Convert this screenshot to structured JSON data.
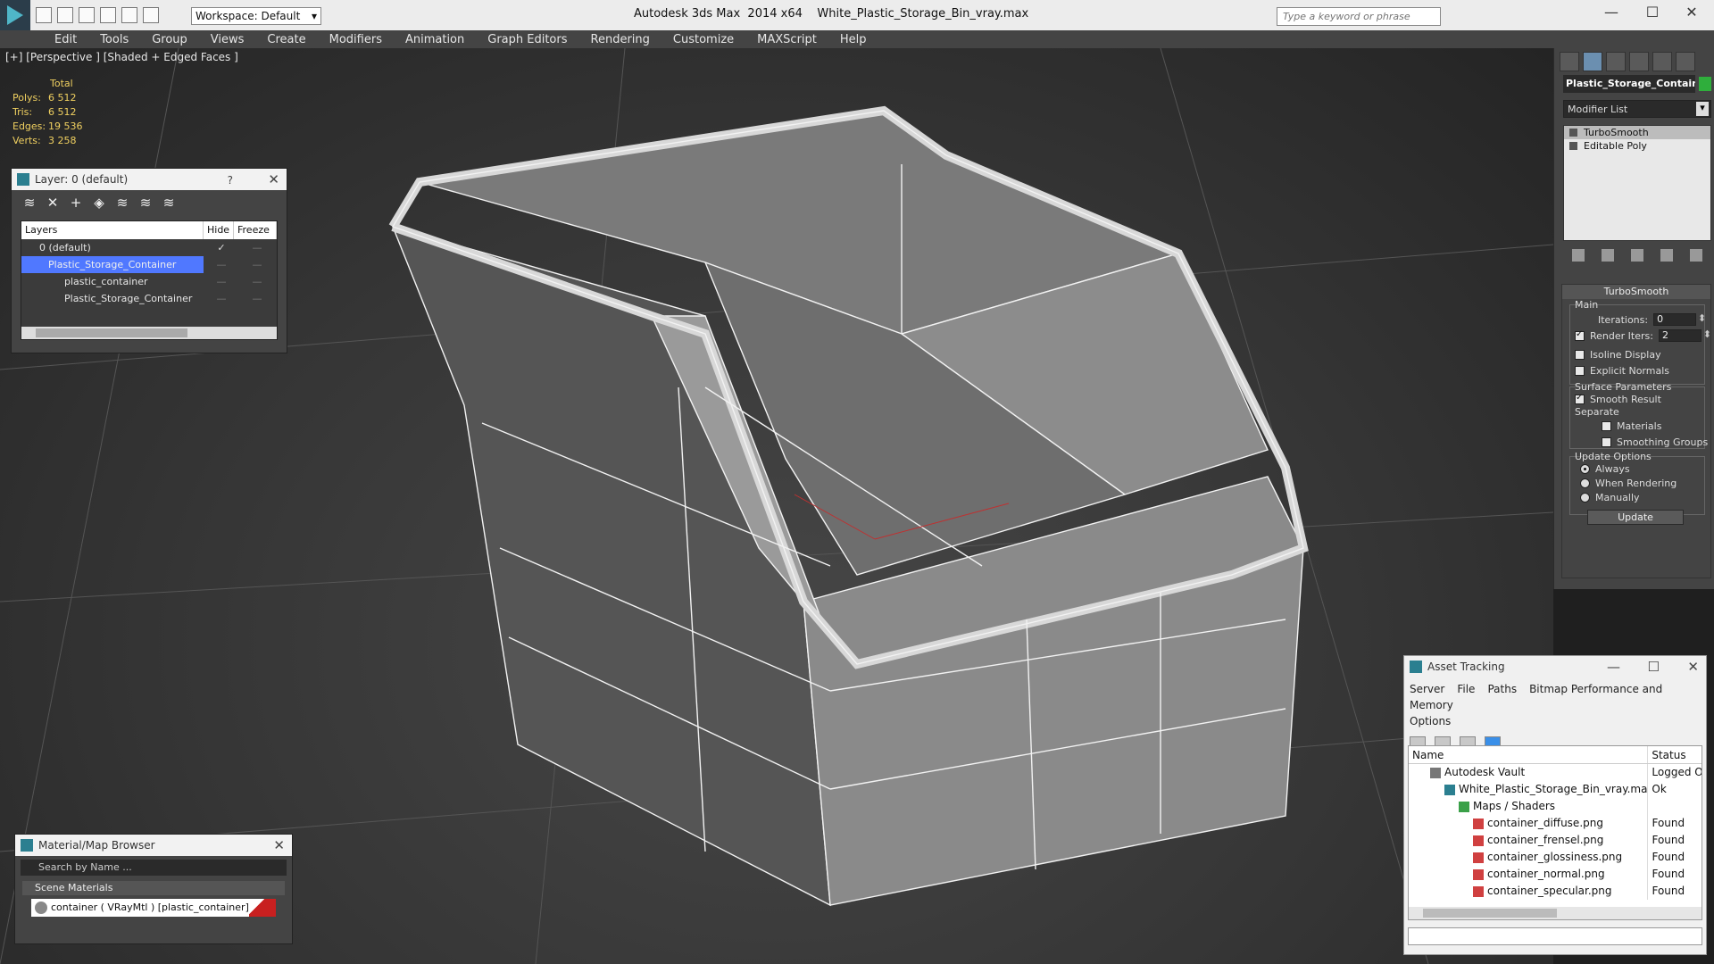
{
  "titlebar": {
    "app_title": "Autodesk 3ds Max  2014 x64",
    "file_name": "White_Plastic_Storage_Bin_vray.max",
    "workspace": "Workspace: Default",
    "search_placeholder": "Type a keyword or phrase"
  },
  "menu": [
    "Edit",
    "Tools",
    "Group",
    "Views",
    "Create",
    "Modifiers",
    "Animation",
    "Graph Editors",
    "Rendering",
    "Customize",
    "MAXScript",
    "Help"
  ],
  "viewport": {
    "label": "[+] [Perspective ] [Shaded + Edged Faces ]",
    "stats": {
      "header": "Total",
      "rows": [
        {
          "k": "Polys:",
          "v": "6 512"
        },
        {
          "k": "Tris:",
          "v": "6 512"
        },
        {
          "k": "Edges:",
          "v": "19 536"
        },
        {
          "k": "Verts:",
          "v": "3 258"
        }
      ]
    }
  },
  "command_panel": {
    "object_name": "Plastic_Storage_Container",
    "modifier_list": "Modifier List",
    "stack": [
      "TurboSmooth",
      "Editable Poly"
    ],
    "rollout": {
      "title": "TurboSmooth",
      "main_label": "Main",
      "iterations_label": "Iterations:",
      "iterations_value": "0",
      "render_iters_label": "Render Iters:",
      "render_iters_value": "2",
      "isoline": "Isoline Display",
      "explicit_normals": "Explicit Normals",
      "surface_params": "Surface Parameters",
      "smooth_result": "Smooth Result",
      "separate": "Separate",
      "materials": "Materials",
      "smoothing_groups": "Smoothing Groups",
      "update_options": "Update Options",
      "always": "Always",
      "when_rendering": "When Rendering",
      "manually": "Manually",
      "update_button": "Update"
    }
  },
  "layer_panel": {
    "title": "Layer: 0 (default)",
    "help": "?",
    "columns": [
      "Layers",
      "Hide",
      "Freeze"
    ],
    "rows": [
      "0 (default)",
      "Plastic_Storage_Container",
      "plastic_container",
      "Plastic_Storage_Container"
    ]
  },
  "material_browser": {
    "title": "Material/Map Browser",
    "search_placeholder": "Search by Name ...",
    "group": "Scene Materials",
    "item": "container  ( VRayMtl )  [plastic_container]"
  },
  "asset_tracking": {
    "title": "Asset Tracking",
    "menu": [
      "Server",
      "File",
      "Paths",
      "Bitmap Performance and Memory"
    ],
    "menu2": "Options",
    "columns": [
      "Name",
      "Status"
    ],
    "rows": [
      {
        "name": "Autodesk Vault",
        "status": "Logged Ou"
      },
      {
        "name": "White_Plastic_Storage_Bin_vray.max",
        "status": "Ok"
      },
      {
        "name": "Maps / Shaders",
        "status": ""
      },
      {
        "name": "container_diffuse.png",
        "status": "Found"
      },
      {
        "name": "container_frensel.png",
        "status": "Found"
      },
      {
        "name": "container_glossiness.png",
        "status": "Found"
      },
      {
        "name": "container_normal.png",
        "status": "Found"
      },
      {
        "name": "container_specular.png",
        "status": "Found"
      }
    ]
  },
  "colors": {
    "accent": "#5078ff",
    "object_color": "#2fae3c",
    "stats": "#f0d060"
  }
}
